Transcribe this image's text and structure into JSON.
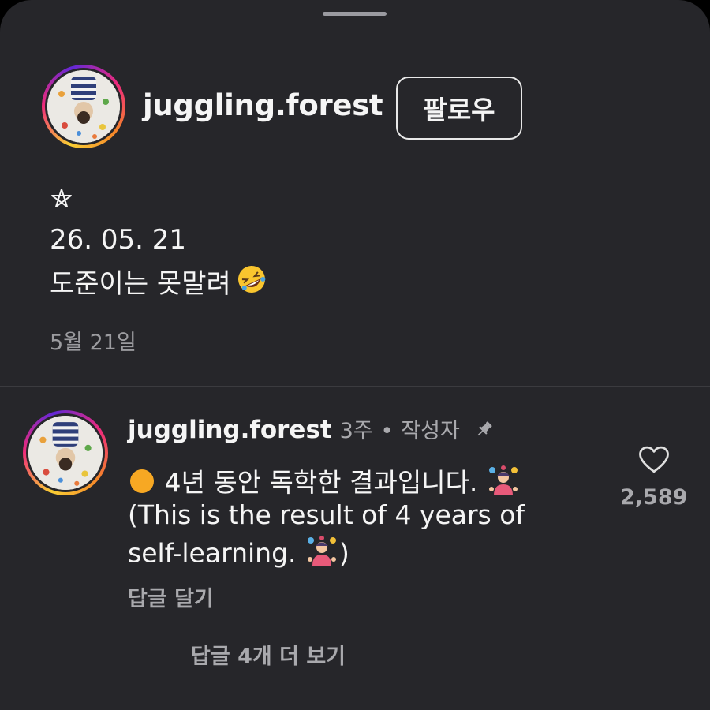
{
  "post": {
    "username": "juggling.forest",
    "follow_label": "팔로우",
    "caption_lines": [
      "26. 05. 21",
      "도준이는 못말려"
    ],
    "date": "5월 21일"
  },
  "comment": {
    "username": "juggling.forest",
    "time": "3주",
    "separator": "•",
    "author_badge": "작성자",
    "text_line_1": "4년 동안 독학한 결과입니다.",
    "text_line_2": "(This is the result of 4 years of",
    "text_line_3_a": "self-learning.",
    "text_line_3_b": ")",
    "reply_label": "답글 달기",
    "like_count": "2,589"
  },
  "more_replies_label": "답글 4개 더 보기",
  "icons": [
    "pentagram-icon",
    "rofl-emoji-icon",
    "pin-icon",
    "orange-circle-emoji-icon",
    "juggler-emoji-icon",
    "heart-icon"
  ],
  "colors": {
    "background": "#26262a",
    "secondary_text": "#a9a9ad",
    "ring_gradient": [
      "#f9ce34",
      "#ee2a7b",
      "#6228d7"
    ]
  }
}
